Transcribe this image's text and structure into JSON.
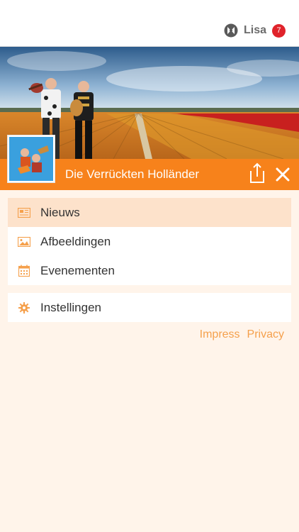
{
  "user": {
    "name": "Lisa",
    "badge_count": "7",
    "logo_icon": "app-logo-icon"
  },
  "header": {
    "title": "Die Verrückten Holländer",
    "share_icon": "share-icon",
    "close_icon": "close-icon"
  },
  "menu": {
    "items": [
      {
        "label": "Nieuws",
        "icon": "newspaper-icon",
        "active": true
      },
      {
        "label": "Afbeeldingen",
        "icon": "image-icon",
        "active": false
      },
      {
        "label": "Evenementen",
        "icon": "calendar-icon",
        "active": false
      }
    ],
    "settings": {
      "label": "Instellingen",
      "icon": "gear-icon"
    }
  },
  "footer": {
    "impress": "Impress",
    "privacy": "Privacy"
  },
  "colors": {
    "accent": "#f7821b",
    "active_bg": "#fde2cb",
    "page_bg": "#fff4ea",
    "link": "#f5a04c",
    "badge": "#e0232b"
  }
}
